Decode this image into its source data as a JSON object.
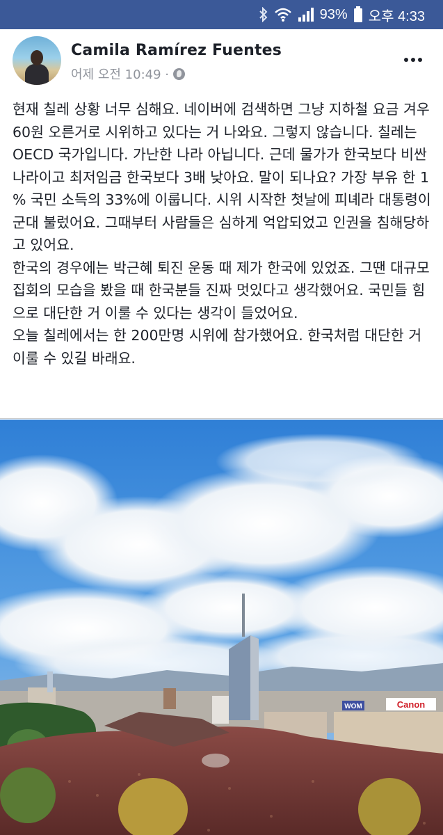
{
  "status_bar": {
    "battery": "93%",
    "time": "오후 4:33",
    "icons": [
      "bluetooth-icon",
      "wifi-icon",
      "signal-icon",
      "battery-icon"
    ]
  },
  "post": {
    "author": "Camila Ramírez Fuentes",
    "timestamp": "어제 오전 10:49 ·",
    "privacy_icon": "globe-icon",
    "menu_icon": "more-icon",
    "body": "현재 칠레 상황 너무 심해요. 네이버에 검색하면 그냥 지하철 요금 겨우 60원 오른거로 시위하고 있다는 거 나와요. 그렇지 않습니다. 칠레는 OECD 국가입니다. 가난한 나라 아닙니다. 근데 물가가 한국보다 비싼 나라이고 최저임금 한국보다 3배 낮아요. 말이 되나요? 가장 부유 한 1 % 국민 소득의 33%에 이룹니다. 시위 시작한 첫날에 피녜라 대통령이 군대 불렀어요. 그때부터 사람들은 심하게 억압되었고 인권을 침해당하고 있어요.\n한국의 경우에는 박근혜 퇴진 운동 때 제가 한국에 있었죠. 그땐 대규모 집회의 모습을 봤을 때 한국분들 진짜 멋있다고 생각했어요. 국민들 힘으로 대단한 거 이룰 수 있다는 생각이 들었어요.\n오늘 칠레에서는 한 200만명 시위에 참가했어요. 한국처럼 대단한 거 이룰 수 있길 바래요.",
    "photo": {
      "description_signs": [
        "WOM",
        "Canon"
      ]
    }
  }
}
